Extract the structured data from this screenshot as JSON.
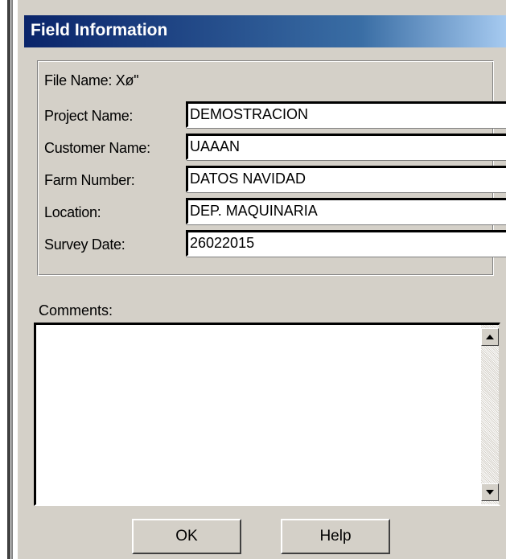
{
  "dialog": {
    "title": "Field Information",
    "file_name_label": "File Name:",
    "file_name_value": "Xø''",
    "fields": [
      {
        "label": "Project Name:",
        "value": "DEMOSTRACION"
      },
      {
        "label": "Customer Name:",
        "value": "UAAAN"
      },
      {
        "label": "Farm Number:",
        "value": "DATOS NAVIDAD"
      },
      {
        "label": "Location:",
        "value": "DEP. MAQUINARIA"
      },
      {
        "label": "Survey Date:",
        "value": "26022015"
      }
    ],
    "comments_label": "Comments:",
    "comments_value": "",
    "ok_label": "OK",
    "help_label": "Help"
  },
  "icons": {
    "scroll_up": "arrow-up-icon",
    "scroll_down": "arrow-down-icon"
  },
  "colors": {
    "titlebar_start": "#0a246a",
    "titlebar_end": "#a6caf0",
    "dialog_face": "#d4d0c8"
  }
}
